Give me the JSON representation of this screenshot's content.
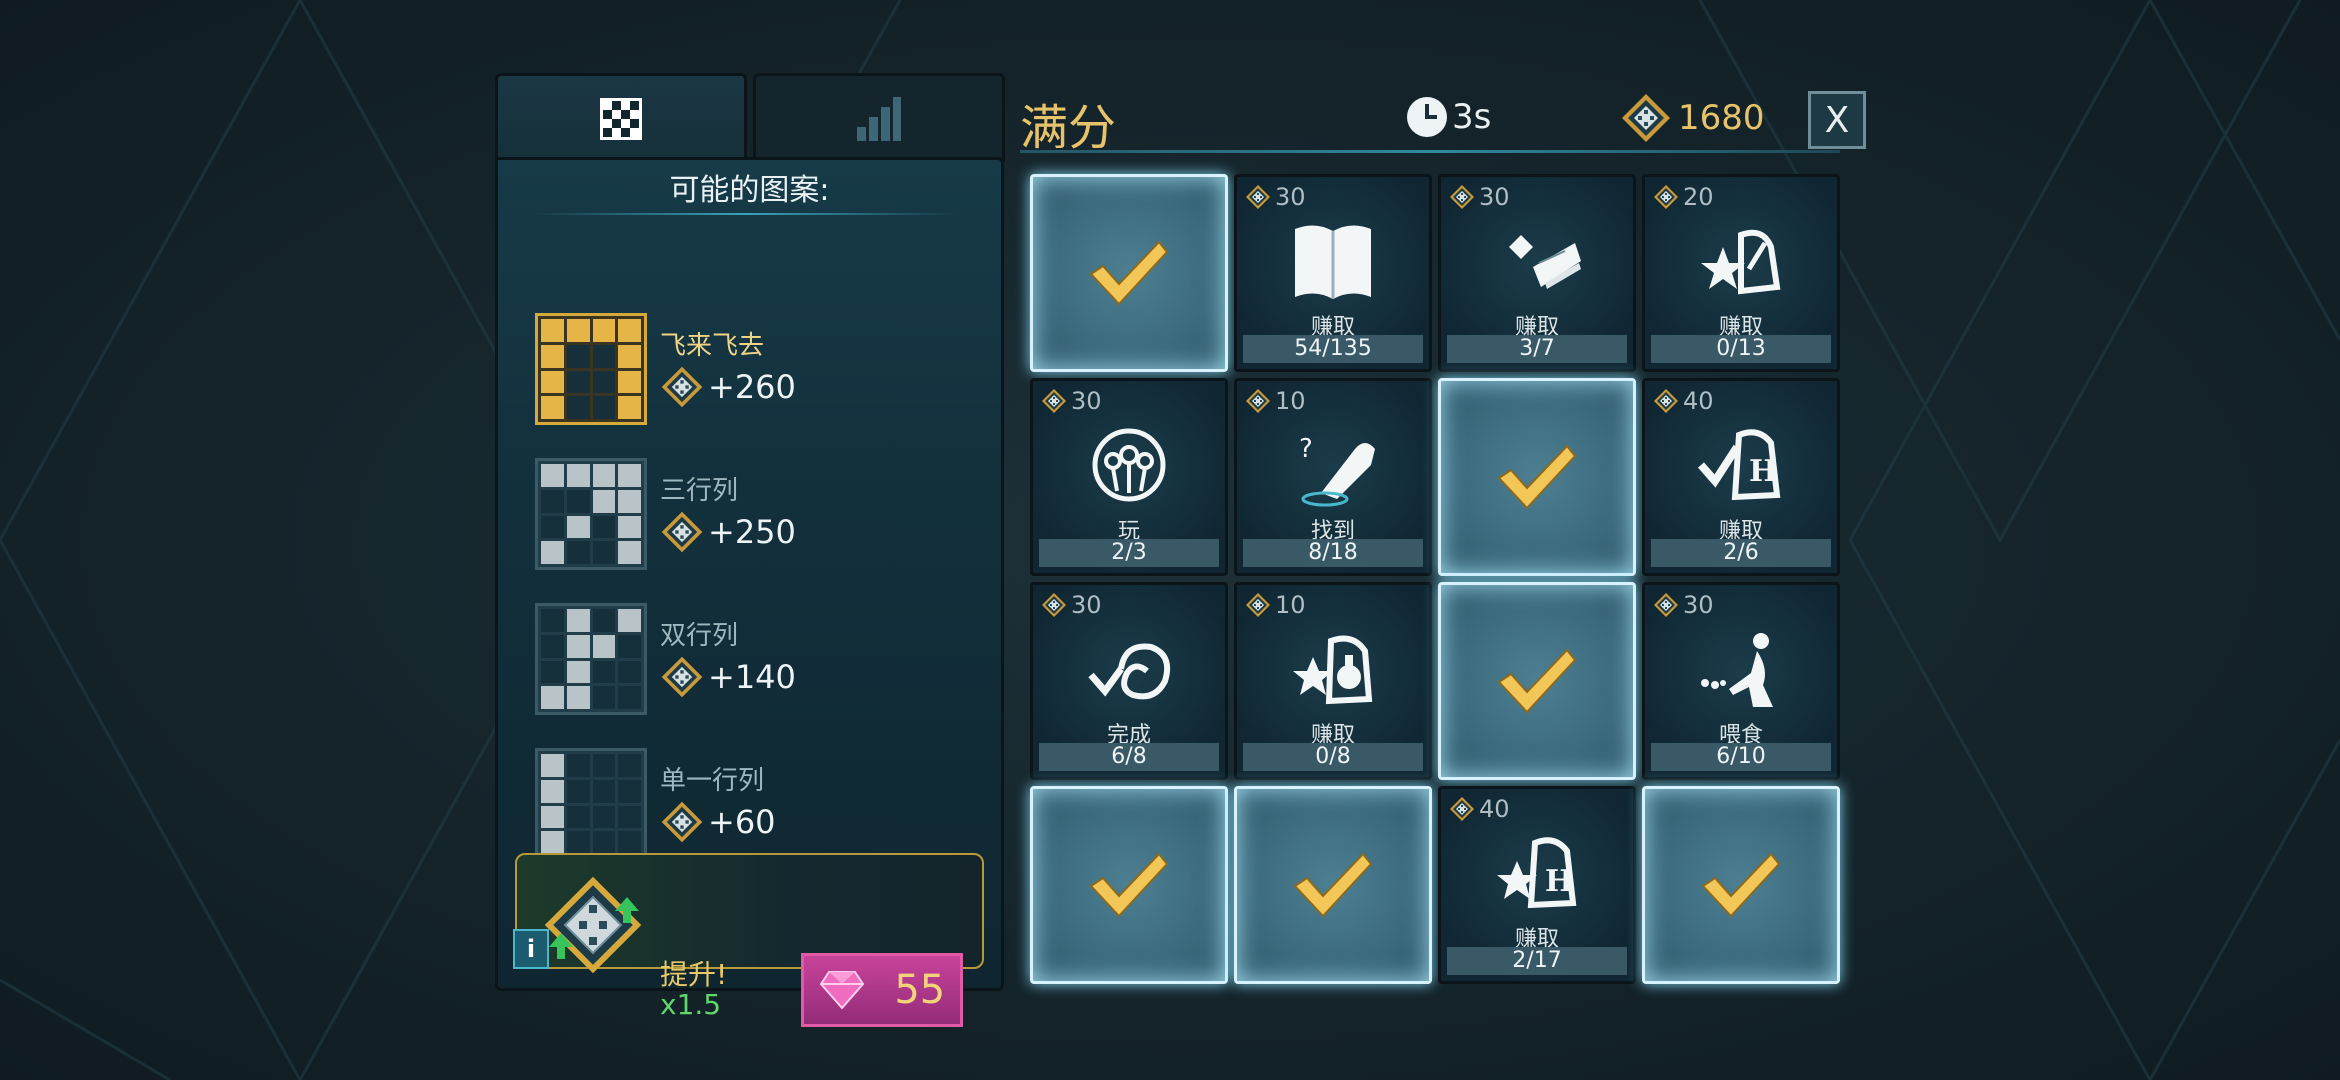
{
  "colors": {
    "gold": "#e6c36a",
    "accent": "#2f8aa0",
    "gem_pink": "#c8439a",
    "boost_green": "#5fd66a"
  },
  "left_panel": {
    "tabs": [
      {
        "icon": "checker-pattern-icon"
      },
      {
        "icon": "bar-stats-icon"
      }
    ],
    "title": "可能的图案:",
    "patterns": [
      {
        "name": "飞来飞去",
        "reward": "+260",
        "highlight": true,
        "cells": [
          1,
          1,
          1,
          1,
          1,
          0,
          0,
          1,
          1,
          0,
          0,
          1,
          1,
          0,
          0,
          1
        ]
      },
      {
        "name": "三行列",
        "reward": "+250",
        "highlight": false,
        "cells": [
          1,
          1,
          1,
          1,
          0,
          0,
          1,
          1,
          0,
          1,
          0,
          1,
          1,
          0,
          0,
          1
        ]
      },
      {
        "name": "双行列",
        "reward": "+140",
        "highlight": false,
        "cells": [
          0,
          1,
          0,
          1,
          0,
          1,
          1,
          0,
          0,
          1,
          0,
          0,
          1,
          1,
          0,
          0
        ]
      },
      {
        "name": "单一行列",
        "reward": "+60",
        "highlight": false,
        "cells": [
          1,
          0,
          0,
          0,
          1,
          0,
          0,
          0,
          1,
          0,
          0,
          0,
          1,
          0,
          0,
          0
        ]
      }
    ],
    "boost": {
      "info": "i",
      "label": "提升!",
      "multiplier": "x1.5",
      "price": "55"
    }
  },
  "header": {
    "title": "满分",
    "timer": "3s",
    "coins": "1680",
    "close": "X"
  },
  "tiles": [
    {
      "done": true
    },
    {
      "cost": "30",
      "icon": "book-icon",
      "label": "赚取",
      "progress": "54/135"
    },
    {
      "cost": "30",
      "icon": "card-pieces-icon",
      "label": "赚取",
      "progress": "3/7"
    },
    {
      "cost": "20",
      "icon": "star-wand-icon",
      "label": "赚取",
      "progress": "0/13"
    },
    {
      "cost": "30",
      "icon": "quidditch-icon",
      "label": "玩",
      "progress": "2/3"
    },
    {
      "cost": "10",
      "icon": "pointing-hand-icon",
      "label": "找到",
      "progress": "8/18"
    },
    {
      "done": true
    },
    {
      "cost": "40",
      "icon": "check-house-icon",
      "label": "赚取",
      "progress": "2/6"
    },
    {
      "cost": "30",
      "icon": "check-swirl-icon",
      "label": "完成",
      "progress": "6/8"
    },
    {
      "cost": "10",
      "icon": "star-potion-icon",
      "label": "赚取",
      "progress": "0/8"
    },
    {
      "done": true
    },
    {
      "cost": "30",
      "icon": "feeding-figure-icon",
      "label": "喂食",
      "progress": "6/10"
    },
    {
      "done": true
    },
    {
      "done": true
    },
    {
      "cost": "40",
      "icon": "star-house-icon",
      "label": "赚取",
      "progress": "2/17"
    },
    {
      "done": true
    }
  ]
}
